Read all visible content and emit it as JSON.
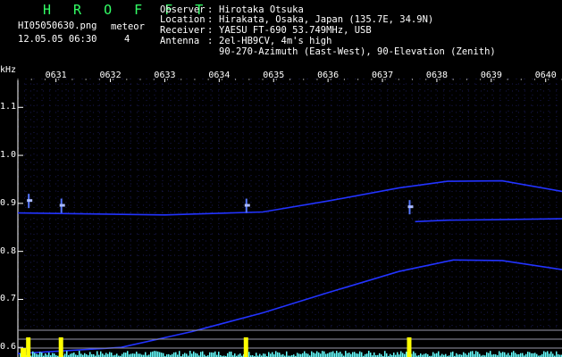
{
  "header": {
    "brand": "H R O F F T",
    "filename": "HI05050630.png",
    "meteor_label": "meteor",
    "timestamp": "12.05.05 06:30",
    "meteor_count": "4",
    "observer_key": "Observer",
    "observer_val": "Hirotaka Otsuka",
    "location_key": "Location",
    "location_val": "Hirakata, Osaka, Japan (135.7E, 34.9N)",
    "receiver_key": "Receiver",
    "receiver_val": "YAESU FT-690 53.749MHz, USB",
    "antenna_key": "Antenna",
    "antenna_val": "2el-HB9CV, 4m's high",
    "antenna_val2": "90-270-Azimuth (East-West), 90-Elevation (Zenith)"
  },
  "chart_data": {
    "type": "heatmap",
    "ylabel": "kHz",
    "x_ticks": [
      "0631",
      "0632",
      "0633",
      "0634",
      "0635",
      "0636",
      "0637",
      "0638",
      "0639",
      "0640"
    ],
    "y_ticks": [
      1.1,
      1.0,
      0.9,
      0.8,
      0.7,
      0.6
    ],
    "xlim": [
      630.3,
      640.3
    ],
    "ylim": [
      0.58,
      1.16
    ],
    "colors": {
      "trace": "#2233ff",
      "grid": "#1a1a55",
      "signal": "#66ffff",
      "meteor": "#ffff00",
      "band": "#9999aa"
    },
    "traces": [
      {
        "x": [
          630.3,
          632.2,
          633.5,
          634.8,
          636.0,
          637.3,
          638.3,
          639.2,
          640.3
        ],
        "y": [
          0.587,
          0.6,
          0.633,
          0.672,
          0.714,
          0.758,
          0.782,
          0.781,
          0.762
        ]
      },
      {
        "x": [
          630.3,
          633.0,
          634.8,
          636.0,
          637.3,
          638.2,
          639.2,
          640.3
        ],
        "y": [
          0.88,
          0.876,
          0.882,
          0.905,
          0.932,
          0.946,
          0.947,
          0.925
        ]
      },
      {
        "x": [
          637.6,
          638.2,
          639.0,
          640.3
        ],
        "y": [
          0.862,
          0.865,
          0.866,
          0.868
        ]
      }
    ],
    "meteors": [
      {
        "x": 630.5,
        "y": 0.905
      },
      {
        "x": 631.1,
        "y": 0.895
      },
      {
        "x": 634.5,
        "y": 0.895
      },
      {
        "x": 637.5,
        "y": 0.892
      }
    ]
  }
}
